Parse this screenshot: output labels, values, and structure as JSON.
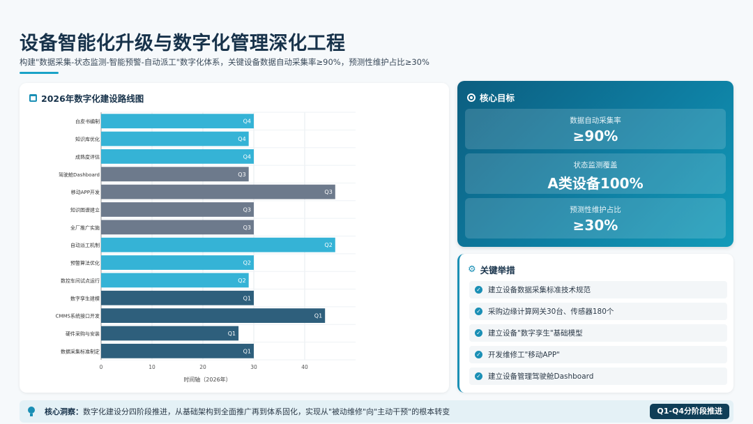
{
  "page": {
    "title": "设备智能化升级与数字化管理深化工程",
    "subtitle": "构建\"数据采集-状态监测-智能预警-自动派工\"数字化体系，关键设备数据自动采集率≥90%，预测性维护占比≥30%"
  },
  "chart_panel": {
    "title": "2026年数字化建设路线图",
    "icon": "calendar-icon"
  },
  "chart_data": {
    "type": "bar",
    "orientation": "horizontal",
    "title": "2026年数字化建设路线图",
    "xlabel": "时间轴（2026年）",
    "xlim": [
      0,
      50
    ],
    "xticks": [
      0,
      10,
      20,
      30,
      40
    ],
    "grid": true,
    "categories": [
      "白皮书编制",
      "知识库优化",
      "成熟度评估",
      "驾驶舱Dashboard",
      "移动APP开发",
      "知识图谱建立",
      "全厂推广实施",
      "自动派工机制",
      "预警算法优化",
      "数控车间试点运行",
      "数字孪生建模",
      "CMMS系统接口开发",
      "硬件采购与安装",
      "数据采集标准制定"
    ],
    "values": [
      30,
      29,
      30,
      29,
      46,
      30,
      30,
      46,
      30,
      29,
      30,
      44,
      27,
      30
    ],
    "bar_labels": [
      "Q4",
      "Q4",
      "Q4",
      "Q3",
      "Q3",
      "Q3",
      "Q3",
      "Q2",
      "Q2",
      "Q2",
      "Q1",
      "Q1",
      "Q1",
      "Q1"
    ],
    "phase_colors": {
      "Q1": "#2e5f7c",
      "Q2": "#35b3d6",
      "Q3": "#6d7a8c",
      "Q4": "#35b3d6"
    }
  },
  "goals": {
    "title": "核心目标",
    "icon": "target-icon",
    "items": [
      {
        "label": "数据自动采集率",
        "value": "≥90%"
      },
      {
        "label": "状态监测覆盖",
        "value": "A类设备100%"
      },
      {
        "label": "预测性维护占比",
        "value": "≥30%"
      }
    ]
  },
  "measures": {
    "title": "关键举措",
    "icon": "gears-icon",
    "items": [
      "建立设备数据采集标准技术规范",
      "采购边缘计算网关30台、传感器180个",
      "建立设备\"数字孪生\"基础模型",
      "开发维修工\"移动APP\"",
      "建立设备管理驾驶舱Dashboard"
    ]
  },
  "insight": {
    "label": "核心洞察：",
    "text": "数字化建设分四阶段推进，从基础架构到全面推广再到体系固化，实现从\"被动维修\"向\"主动干预\"的根本转变",
    "badge": "Q1-Q4分阶段推进",
    "icon": "lightbulb-icon"
  }
}
